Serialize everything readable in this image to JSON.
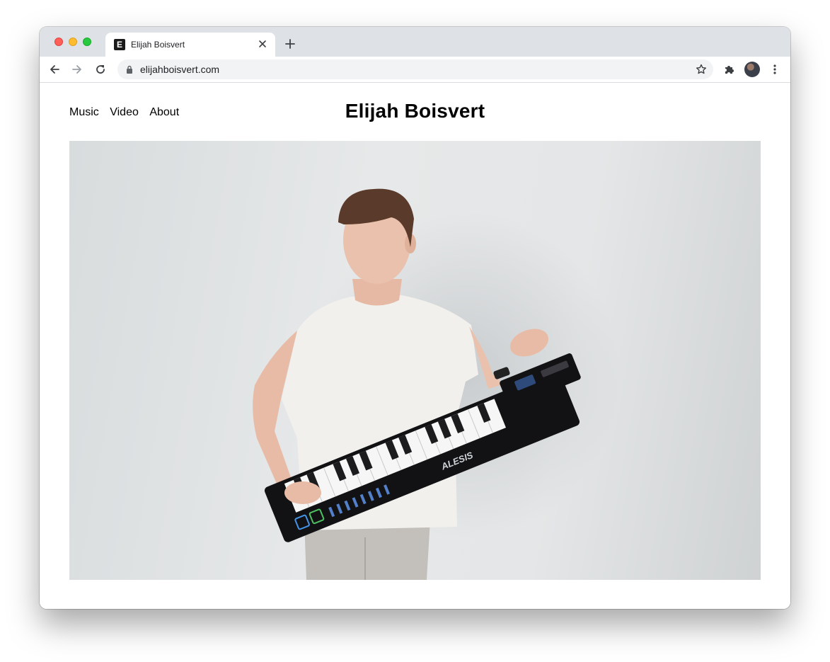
{
  "browser": {
    "tab_title": "Elijah Boisvert",
    "favicon_letter": "E",
    "url": "elijahboisvert.com"
  },
  "site": {
    "title": "Elijah Boisvert",
    "nav": [
      {
        "label": "Music"
      },
      {
        "label": "Video"
      },
      {
        "label": "About"
      }
    ]
  },
  "hero": {
    "keyboard_brand": "ALESIS"
  },
  "icons": {
    "back": "arrow-left-icon",
    "forward": "arrow-right-icon",
    "reload": "reload-icon",
    "lock": "lock-icon",
    "bookmark": "star-icon",
    "extensions": "puzzle-icon",
    "menu": "kebab-menu-icon"
  }
}
